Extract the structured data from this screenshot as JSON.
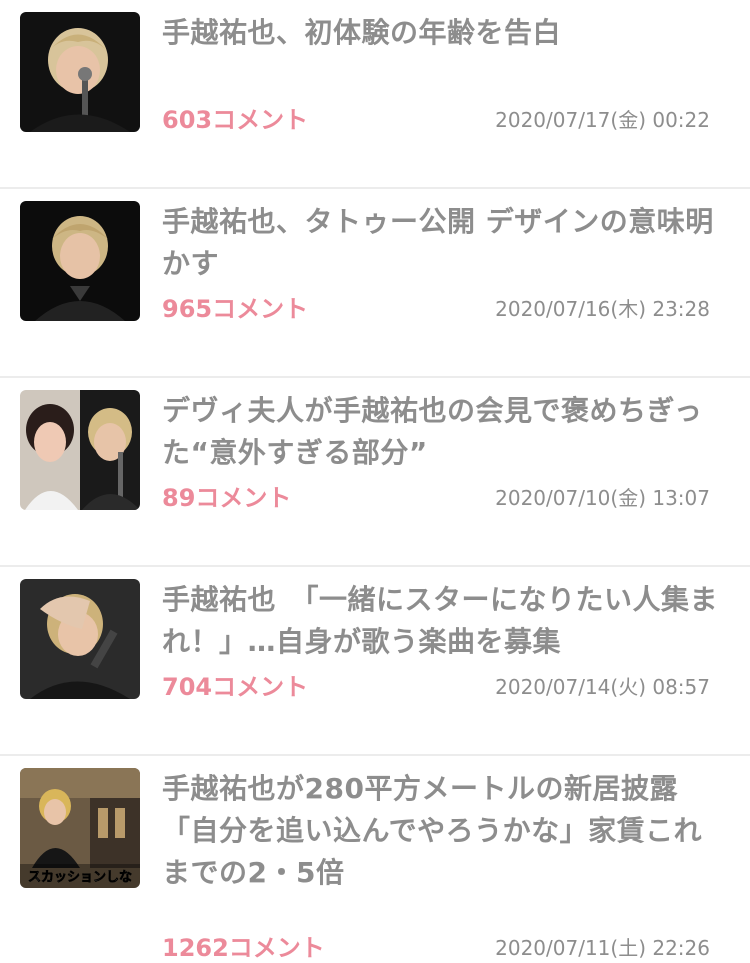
{
  "articles": [
    {
      "title": "手越祐也、初体験の年齢を告白",
      "comments": "603コメント",
      "date": "2020/07/17(金) 00:22"
    },
    {
      "title": "手越祐也、タトゥー公開 デザインの意味明かす",
      "comments": "965コメント",
      "date": "2020/07/16(木) 23:28"
    },
    {
      "title": "デヴィ夫人が手越祐也の会見で褒めちぎった“意外すぎる部分”",
      "comments": "89コメント",
      "date": "2020/07/10(金) 13:07"
    },
    {
      "title": "手越祐也　「一緒にスターになりたい人集まれ！」…自身が歌う楽曲を募集",
      "comments": "704コメント",
      "date": "2020/07/14(火) 08:57"
    },
    {
      "title": "手越祐也が280平方メートルの新居披露「自分を追い込んでやろうかな」家賃これまでの2・5倍",
      "comments": "1262コメント",
      "date": "2020/07/11(土) 22:26",
      "thumb_caption": "スカッションしな"
    }
  ]
}
